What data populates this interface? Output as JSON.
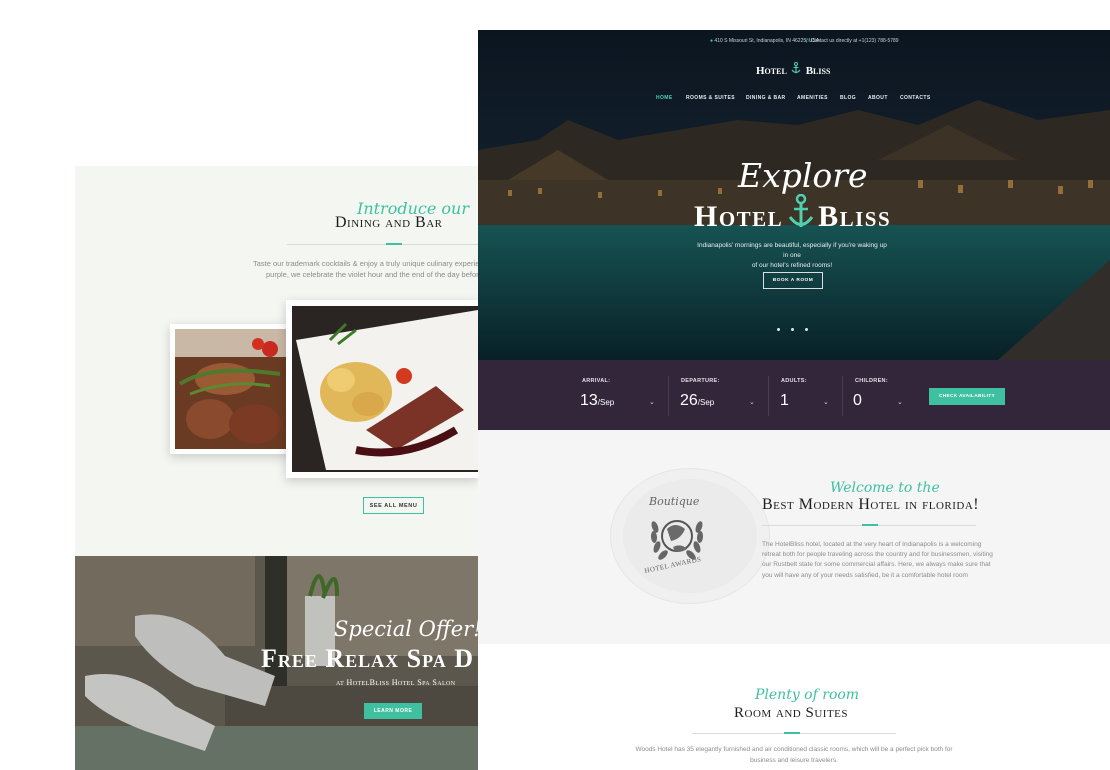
{
  "colors": {
    "accent": "#3fc0a0",
    "booking_bar": "#33253a",
    "heading": "#1d1d1d",
    "body_text": "#8c8c8c"
  },
  "back_page": {
    "dining": {
      "intro": "Introduce our",
      "title": "Dining and Bar",
      "body_line1": "Taste our trademark cocktails & enjoy a truly unique culinary experience.   As the sun",
      "body_line2": "purple, we celebrate the violet hour and the end of the day before welcoming the",
      "menu_button": "SEE ALL MENU"
    },
    "spa": {
      "script": "Special Offer!",
      "title": "Free Relax Spa D",
      "subtitle": "at HotelBliss Hotel Spa Salon",
      "button": "LEARN MORE"
    }
  },
  "front_page": {
    "topbar": {
      "address_icon": "map-pin-icon",
      "address": "410 S Missouri St, Indianapolis, IN 46225, USA",
      "phone_icon": "phone-icon",
      "phone": "Contact us directly at +1(123) 788-5789"
    },
    "logo": {
      "left": "Hotel",
      "right": "Bliss",
      "icon": "anchor-icon"
    },
    "nav": [
      {
        "label": "HOME",
        "active": true
      },
      {
        "label": "ROOMS & SUITES",
        "active": false
      },
      {
        "label": "DINING & BAR",
        "active": false
      },
      {
        "label": "AMENITIES",
        "active": false
      },
      {
        "label": "BLOG",
        "active": false
      },
      {
        "label": "ABOUT",
        "active": false
      },
      {
        "label": "CONTACTS",
        "active": false
      }
    ],
    "hero": {
      "script": "Explore",
      "title_left": "Hotel",
      "title_right": "Bliss",
      "desc_line1": "Indianapolis' mornings are beautiful,  especially if you're waking up in one",
      "desc_line2": "of our hotel's refined rooms!",
      "button": "BOOK A ROOM",
      "slides": 3
    },
    "booking": {
      "arrival_label": "ARRIVAL:",
      "arrival_day": "13",
      "arrival_month": "/Sep",
      "departure_label": "DEPARTURE:",
      "departure_day": "26",
      "departure_month": "/Sep",
      "adults_label": "ADULTS:",
      "adults_value": "1",
      "children_label": "CHILDREN:",
      "children_value": "0",
      "caret": "⌄",
      "check_button": "CHECK AVAILABILITY"
    },
    "welcome": {
      "badge_top": "Boutique",
      "badge_bottom": "HOTEL AWARDS",
      "intro": "Welcome to the",
      "title": "Best Modern Hotel in florida!",
      "body": [
        "The HotelBliss hotel, located at the very heart of Indianapolis is a welcoming",
        "retreat both for people traveling across the country and for businessmen, visiting",
        "our Rustbelt state for some commercial affairs. Here, we always make sure that",
        "you will have any of your needs satisfied, be it a comfortable hotel room"
      ]
    },
    "rooms": {
      "intro": "Plenty of room",
      "title": "Room and Suites",
      "body_line1": "Woods Hotel has 35 elegantly furnished and air conditioned classic rooms, which will be a perfect pick both for",
      "body_line2": "business and leisure travelers."
    }
  }
}
